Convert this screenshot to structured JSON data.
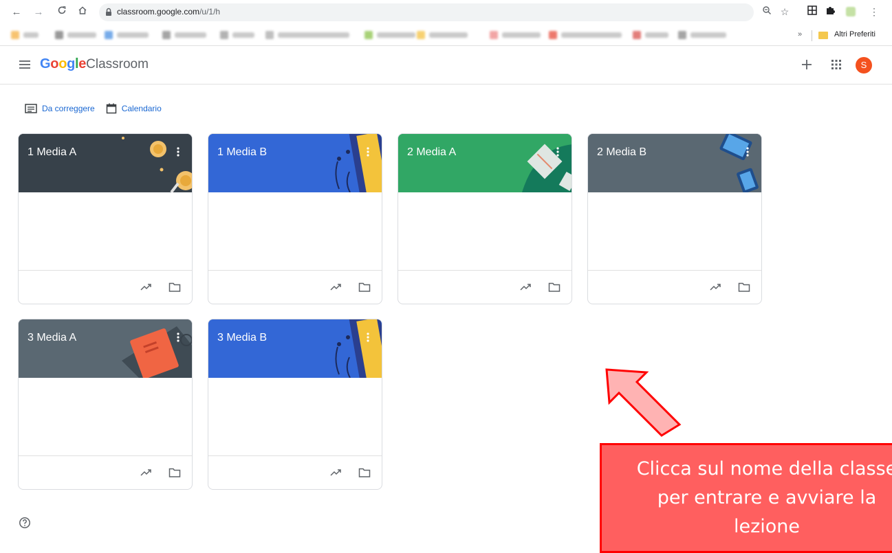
{
  "browser": {
    "url_host": "classroom.google.com",
    "url_path": "/u/1/h",
    "bookmarks_more": "»",
    "bookmark_folder_label": "Altri Preferiti"
  },
  "header": {
    "logo_google": "Google",
    "logo_product": "Classroom",
    "avatar_initial": "S",
    "avatar_color": "#f4511e"
  },
  "subnav": {
    "to_review_label": "Da correggere",
    "calendar_label": "Calendario"
  },
  "classes": [
    {
      "title": "1 Media A",
      "color": "#37414a"
    },
    {
      "title": "1 Media B",
      "color": "#3367d6"
    },
    {
      "title": "2 Media A",
      "color": "#31a765"
    },
    {
      "title": "2 Media B",
      "color": "#5a6872"
    },
    {
      "title": "3 Media A",
      "color": "#5a6872"
    },
    {
      "title": "3 Media B",
      "color": "#3367d6"
    }
  ],
  "annotation": {
    "text": "Clicca sul nome della classe\nper entrare e avviare la\nlezione",
    "arrow_fill": "#ffb3b3",
    "arrow_stroke": "#ff0000"
  }
}
